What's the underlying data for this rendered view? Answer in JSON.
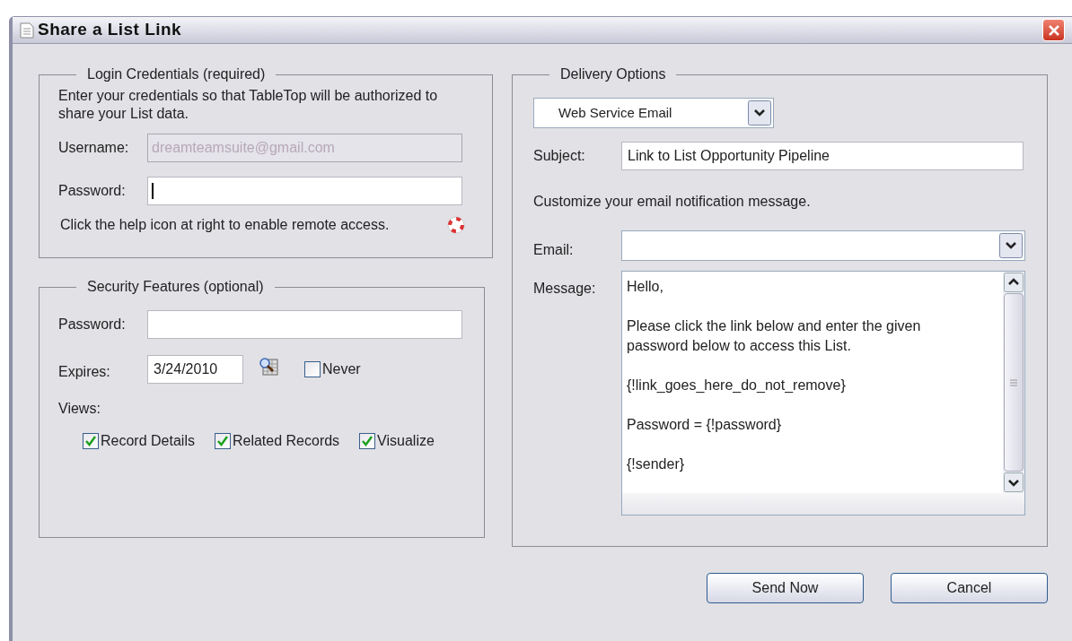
{
  "window": {
    "title": "Share a List Link"
  },
  "login": {
    "legend": "Login Credentials (required)",
    "intro": "Enter your credentials so that TableTop will be authorized to share your List data.",
    "username": {
      "label": "Username:",
      "value": "dreamteamsuite@gmail.com",
      "disabled": true
    },
    "password": {
      "label": "Password:",
      "focused": true
    },
    "help_text": "Click the help icon at right to enable remote access."
  },
  "security": {
    "legend": "Security Features (optional)",
    "password": {
      "label": "Password:"
    },
    "expires": {
      "label": "Expires:",
      "value": "3/24/2010"
    },
    "never": {
      "label": "Never",
      "checked": false
    },
    "views_label": "Views:",
    "views": [
      {
        "label": "Record Details",
        "checked": true
      },
      {
        "label": "Related Records",
        "checked": true
      },
      {
        "label": "Visualize",
        "checked": true
      }
    ]
  },
  "delivery": {
    "legend": "Delivery Options",
    "method": "Web Service Email",
    "subject": {
      "label": "Subject:",
      "value": "Link to List Opportunity Pipeline"
    },
    "customize_text": "Customize your email notification message.",
    "email": {
      "label": "Email:"
    },
    "message": {
      "label": "Message:",
      "paragraphs": [
        "Hello,",
        "Please click the link below and enter the given password below to access this List.",
        "{!link_goes_here_do_not_remove}",
        "Password = {!password}",
        "{!sender}"
      ]
    }
  },
  "buttons": [
    "Send Now",
    "Cancel"
  ]
}
